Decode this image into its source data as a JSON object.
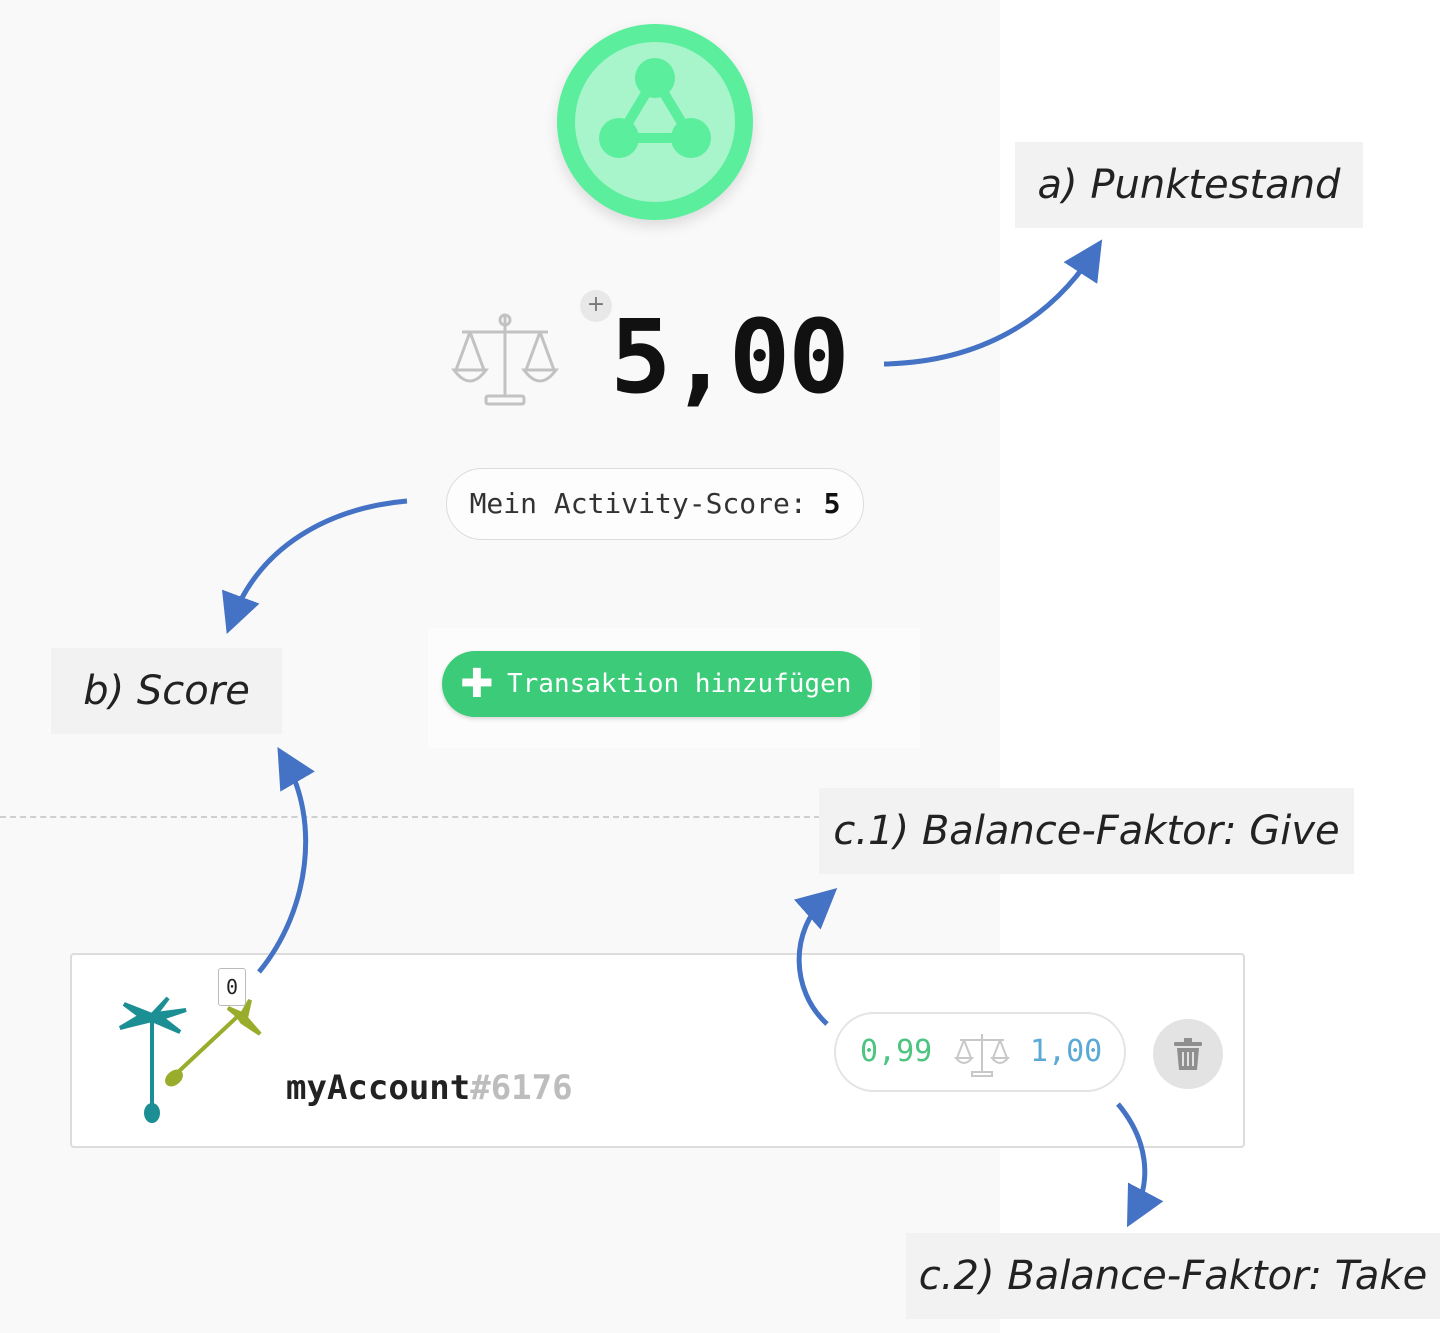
{
  "balance": {
    "value": "5,00",
    "plus_icon": "plus-icon",
    "scale_icon": "scale-icon"
  },
  "activity": {
    "label": "Mein Activity-Score:",
    "value": "5"
  },
  "add_transaction": {
    "icon": "plus-icon",
    "label": "Transaktion hinzufügen"
  },
  "account": {
    "score": "0",
    "name": "myAccount",
    "tag": "#6176",
    "balance_give": "0,99",
    "balance_take": "1,00",
    "delete_icon": "trash-icon"
  },
  "annotations": {
    "a": "a) Punktestand",
    "b": "b) Score",
    "c1": "c.1) Balance-Faktor: Give",
    "c2": "c.2) Balance-Faktor: Take"
  },
  "colors": {
    "accent_green": "#3ccc79",
    "logo_green": "#5aee9d",
    "give_color": "#4dc480",
    "take_color": "#5aa9d6",
    "arrow_blue": "#4472c4"
  }
}
